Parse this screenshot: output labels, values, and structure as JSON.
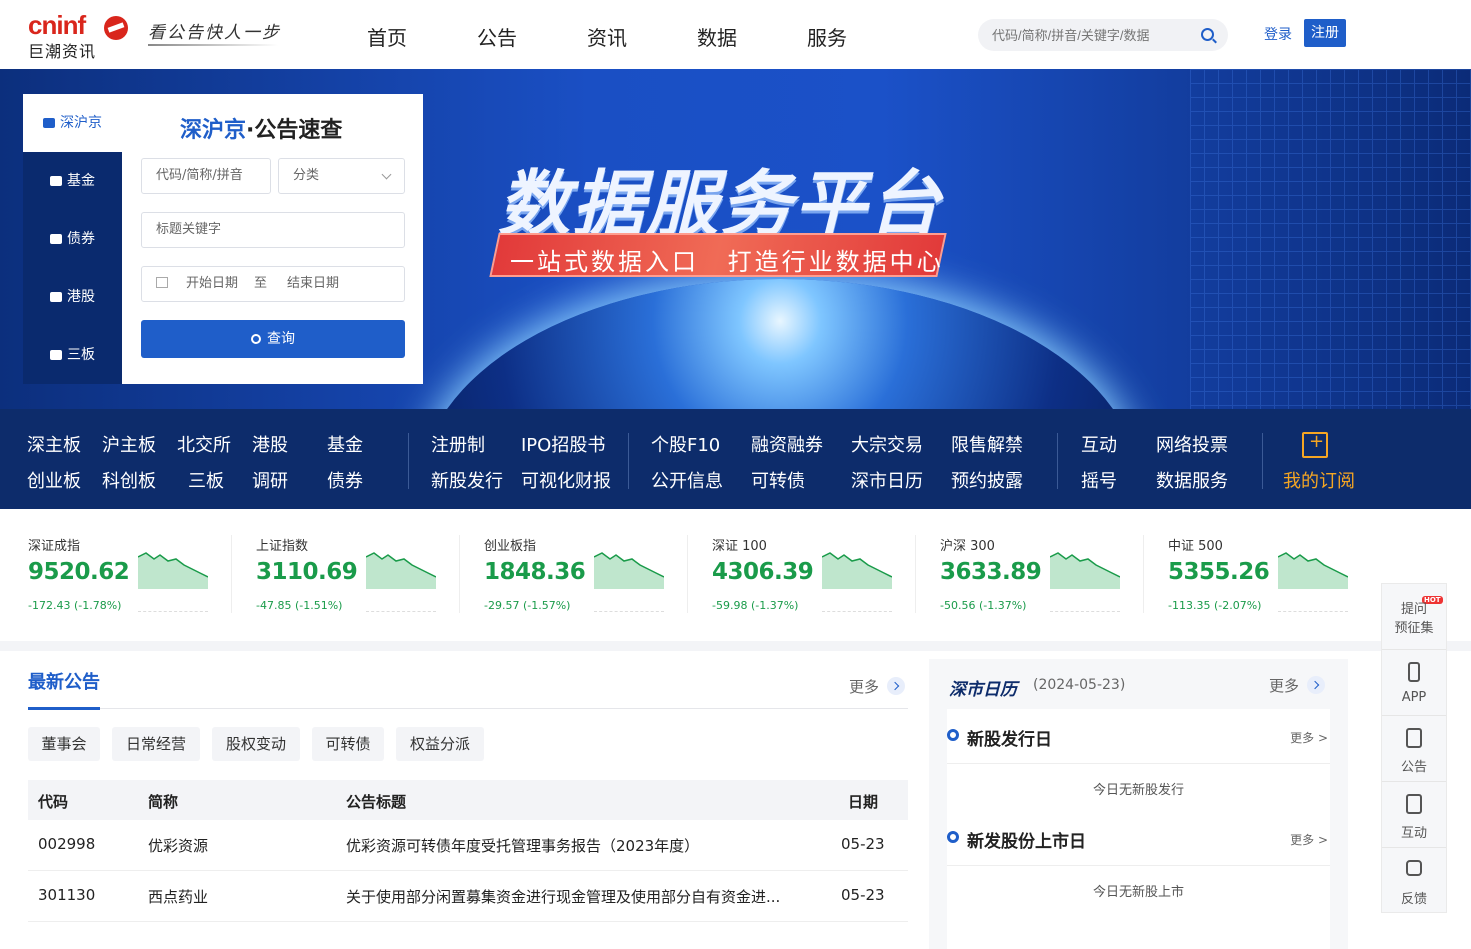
{
  "header": {
    "brand": "cninf",
    "brand_cn": "巨潮资讯",
    "slogan": "看公告快人一步",
    "nav": [
      "首页",
      "公告",
      "资讯",
      "数据",
      "服务"
    ],
    "search_placeholder": "代码/简称/拼音/关键字/数据",
    "login": "登录",
    "register": "注册"
  },
  "hero": {
    "title": "数据服务平台",
    "subtitle": "一站式数据入口 打造行业数据中心"
  },
  "query_panel": {
    "tabs": [
      "深沪京",
      "基金",
      "债券",
      "港股",
      "三板"
    ],
    "title_highlight": "深沪京",
    "title_rest": "·公告速查",
    "code_placeholder": "代码/简称/拼音",
    "category": "分类",
    "keyword_placeholder": "标题关键字",
    "start_date": "开始日期",
    "to": "至",
    "end_date": "结束日期",
    "query": "查询"
  },
  "quick_nav": {
    "group1": [
      "深主板",
      "沪主板",
      "北交所",
      "港股",
      "基金",
      "创业板",
      "科创板",
      "三板",
      "调研",
      "债券"
    ],
    "group2": [
      "注册制",
      "IPO招股书",
      "新股发行",
      "可视化财报"
    ],
    "group3": [
      "个股F10",
      "融资融券",
      "大宗交易",
      "限售解禁",
      "公开信息",
      "可转债",
      "深市日历",
      "预约披露"
    ],
    "group4": [
      "互动",
      "网络投票",
      "摇号",
      "数据服务"
    ],
    "subscribe": "我的订阅"
  },
  "indices": [
    {
      "name": "深证成指",
      "value": "9520.62",
      "change": "-172.43 (-1.78%)"
    },
    {
      "name": "上证指数",
      "value": "3110.69",
      "change": "-47.85 (-1.51%)"
    },
    {
      "name": "创业板指",
      "value": "1848.36",
      "change": "-29.57 (-1.57%)"
    },
    {
      "name": "深证 100",
      "value": "4306.39",
      "change": "-59.98 (-1.37%)"
    },
    {
      "name": "沪深 300",
      "value": "3633.89",
      "change": "-50.56 (-1.37%)"
    },
    {
      "name": "中证 500",
      "value": "5355.26",
      "change": "-113.35 (-2.07%)"
    }
  ],
  "announcements": {
    "title": "最新公告",
    "more": "更多",
    "chips": [
      "董事会",
      "日常经营",
      "股权变动",
      "可转债",
      "权益分派"
    ],
    "columns": [
      "代码",
      "简称",
      "公告标题",
      "日期"
    ],
    "rows": [
      {
        "code": "002998",
        "name": "优彩资源",
        "title": "优彩资源可转债年度受托管理事务报告（2023年度）",
        "date": "05-23"
      },
      {
        "code": "301130",
        "name": "西点药业",
        "title": "关于使用部分闲置募集资金进行现金管理及使用部分自有资金进...",
        "date": "05-23"
      }
    ]
  },
  "calendar": {
    "title": "深市日历",
    "date": "(2024-05-23)",
    "more": "更多",
    "events": [
      {
        "title": "新股发行日",
        "more": "更多 >",
        "note": "今日无新股发行"
      },
      {
        "title": "新发股份上市日",
        "more": "更多 >",
        "note": "今日无新股上市"
      }
    ]
  },
  "sidebar": {
    "items": [
      {
        "label": "提问\n预征集",
        "badge": "HOT"
      },
      {
        "label": "APP"
      },
      {
        "label": "公告"
      },
      {
        "label": "互动"
      },
      {
        "label": "反馈"
      }
    ]
  },
  "colors": {
    "brand": "#d9261c",
    "primary": "#1f5ec9",
    "nav_bg": "#0d2c6b",
    "down": "#1a9b4a"
  }
}
